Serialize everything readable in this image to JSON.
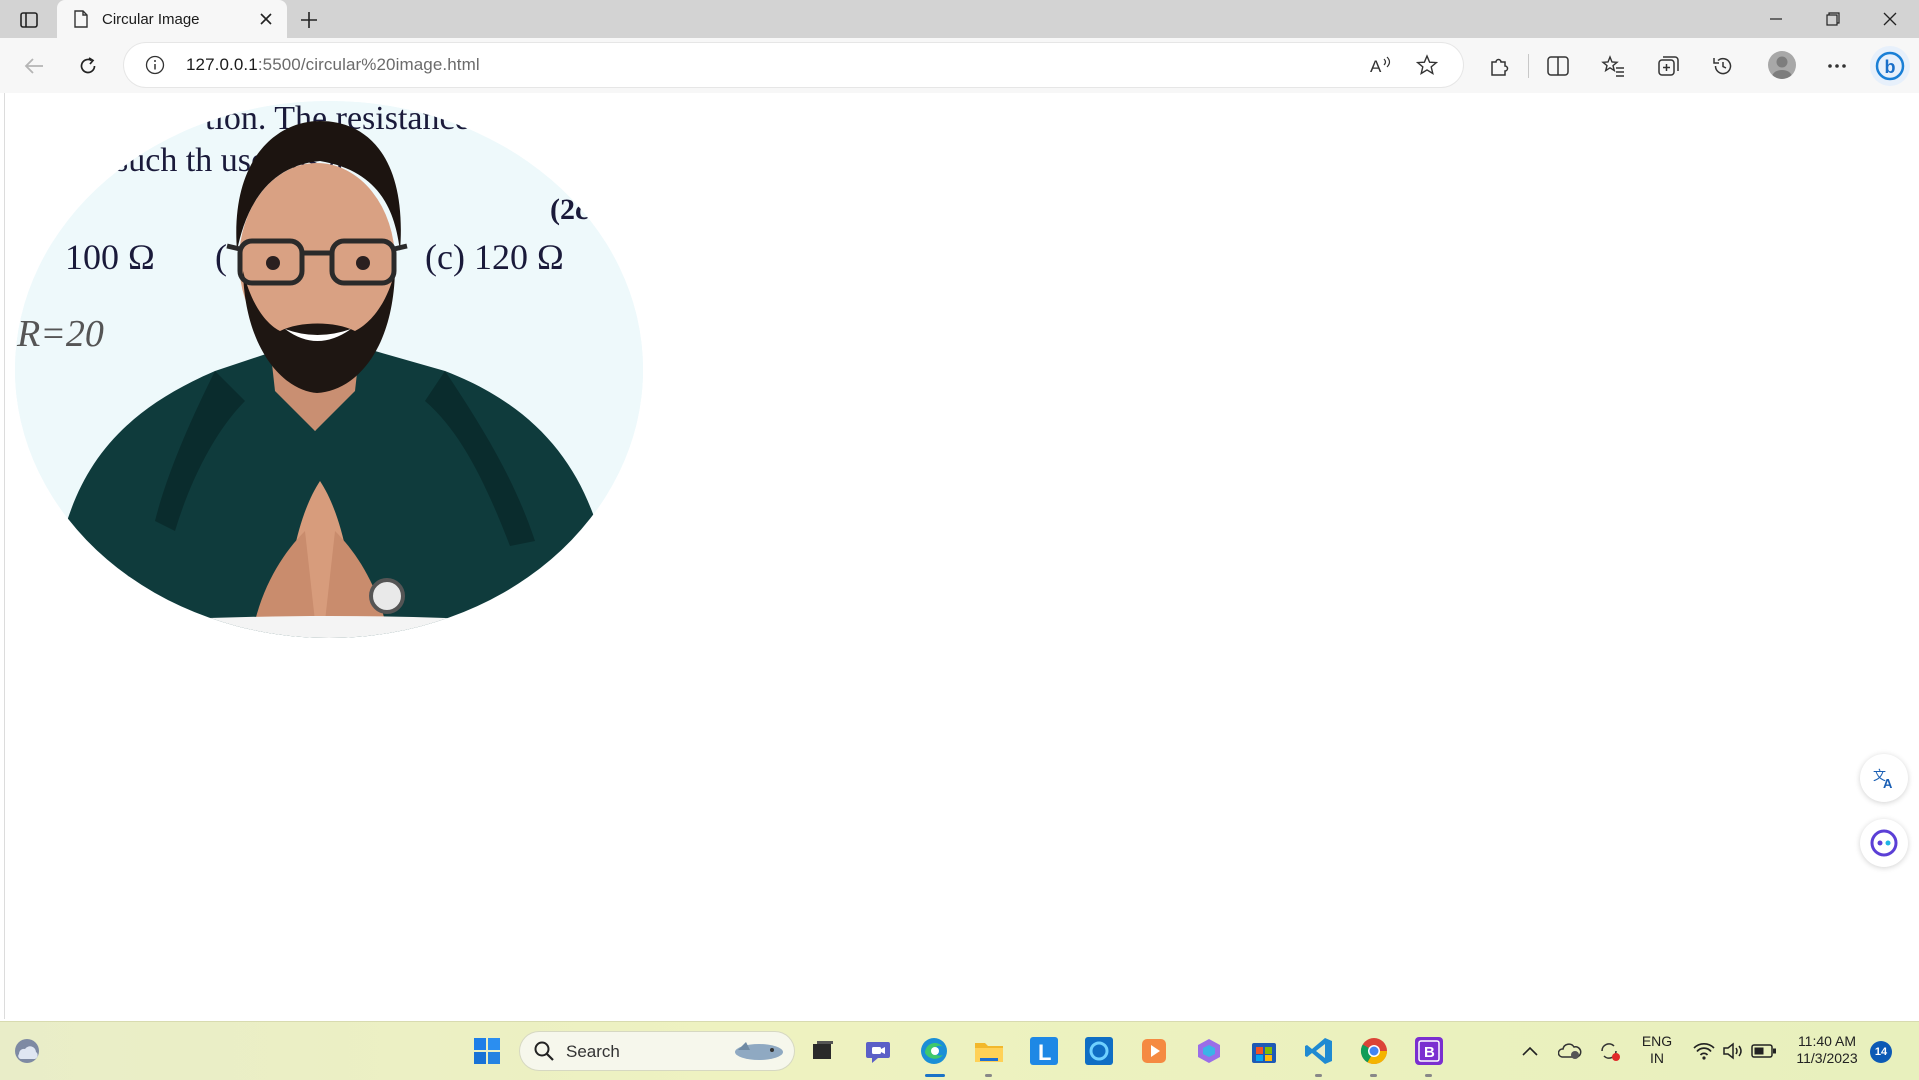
{
  "browser": {
    "tab": {
      "title": "Circular Image",
      "favicon": "page-icon"
    },
    "address": {
      "host": "127.0.0.1",
      "path": ":5500/circular%20image.html"
    }
  },
  "page": {
    "image": {
      "shape": "circle",
      "board_text": {
        "line1": "tion. The resistance",
        "line2": "such th          used as a",
        "ref": "(2c",
        "optA": "100 Ω",
        "optB": "(",
        "optC": "(c)  120 Ω",
        "handwriting": "R=20"
      }
    },
    "side_buttons": [
      "translate-icon",
      "copilot-icon"
    ]
  },
  "taskbar": {
    "search_label": "Search",
    "tray": {
      "lang_line1": "ENG",
      "lang_line2": "IN",
      "time": "11:40 AM",
      "date": "11/3/2023",
      "notifications": "14"
    }
  },
  "colors": {
    "accent": "#0c5ab5",
    "taskbar": "#eef2c0",
    "shirt": "#0f3b3c"
  }
}
